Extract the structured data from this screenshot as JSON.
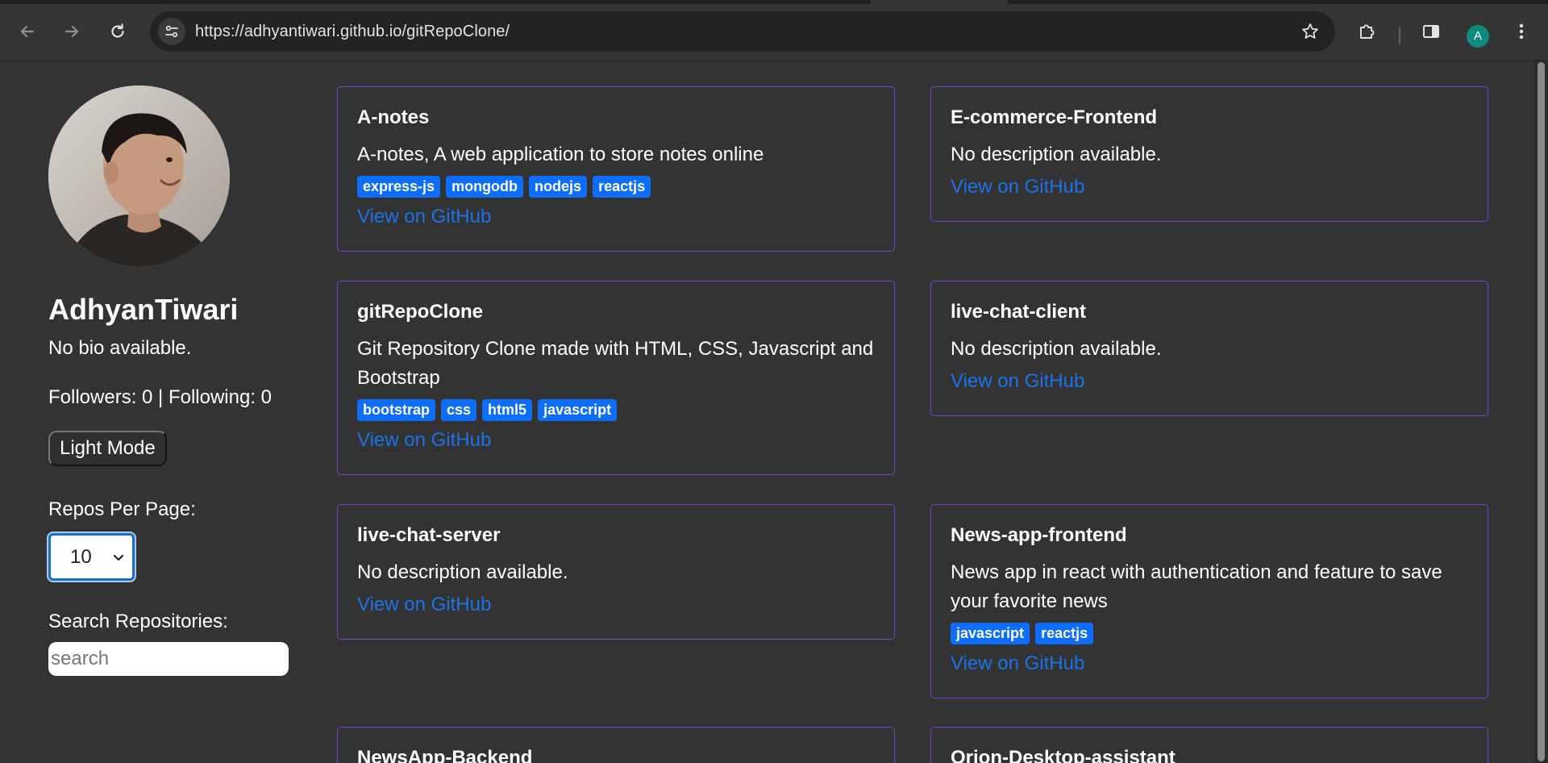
{
  "browser": {
    "url": "https://adhyantiwari.github.io/gitRepoClone/",
    "profile_initial": "A",
    "accent_color": "#0f8a7e"
  },
  "profile": {
    "name": "AdhyanTiwari",
    "bio": "No bio available.",
    "followers_text": "Followers: 0 | Following: 0",
    "mode_button": "Light Mode"
  },
  "controls": {
    "repos_per_page_label": "Repos Per Page:",
    "repos_per_page_value": "10",
    "search_label": "Search Repositories:",
    "search_placeholder": "search"
  },
  "link_label": "View on GitHub",
  "repos": [
    {
      "name": "A-notes",
      "description": "A-notes, A web application to store notes online",
      "topics": [
        "express-js",
        "mongodb",
        "nodejs",
        "reactjs"
      ]
    },
    {
      "name": "E-commerce-Frontend",
      "description": "No description available.",
      "topics": []
    },
    {
      "name": "gitRepoClone",
      "description": "Git Repository Clone made with HTML, CSS, Javascript and Bootstrap",
      "topics": [
        "bootstrap",
        "css",
        "html5",
        "javascript"
      ]
    },
    {
      "name": "live-chat-client",
      "description": "No description available.",
      "topics": []
    },
    {
      "name": "live-chat-server",
      "description": "No description available.",
      "topics": []
    },
    {
      "name": "News-app-frontend",
      "description": "News app in react with authentication and feature to save your favorite news",
      "topics": [
        "javascript",
        "reactjs"
      ]
    },
    {
      "name": "NewsApp-Backend",
      "description": "",
      "topics": []
    },
    {
      "name": "Orion-Desktop-assistant",
      "description": "",
      "topics": []
    }
  ],
  "colors": {
    "page_bg": "#333333",
    "card_border": "#7b3fd1",
    "topic_badge": "#0d6efd",
    "link": "#1a73e8"
  }
}
